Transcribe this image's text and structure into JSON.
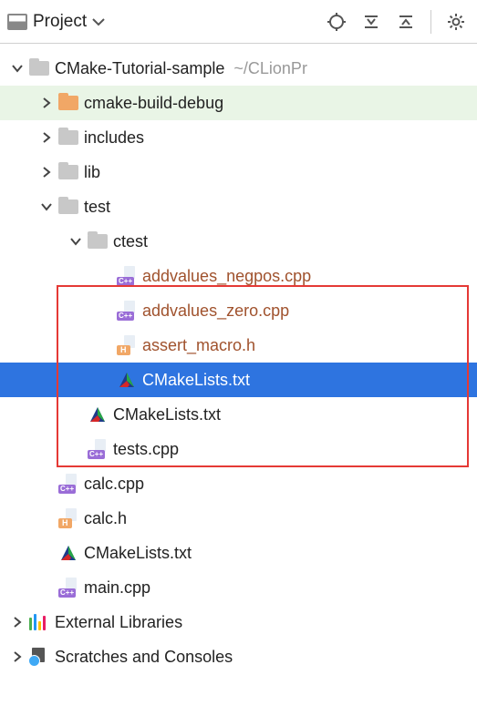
{
  "toolbar": {
    "project_label": "Project"
  },
  "root": {
    "name": "CMake-Tutorial-sample",
    "path": "~/CLionPr"
  },
  "build_dir": "cmake-build-debug",
  "includes": "includes",
  "lib": "lib",
  "test": "test",
  "ctest": "ctest",
  "ctest_files": {
    "f1": "addvalues_negpos.cpp",
    "f2": "addvalues_zero.cpp",
    "f3": "assert_macro.h",
    "f4": "CMakeLists.txt"
  },
  "test_files": {
    "f1": "CMakeLists.txt",
    "f2": "tests.cpp"
  },
  "root_files": {
    "f1": "calc.cpp",
    "f2": "calc.h",
    "f3": "CMakeLists.txt",
    "f4": "main.cpp"
  },
  "ext_lib": "External Libraries",
  "scratches": "Scratches and Consoles"
}
